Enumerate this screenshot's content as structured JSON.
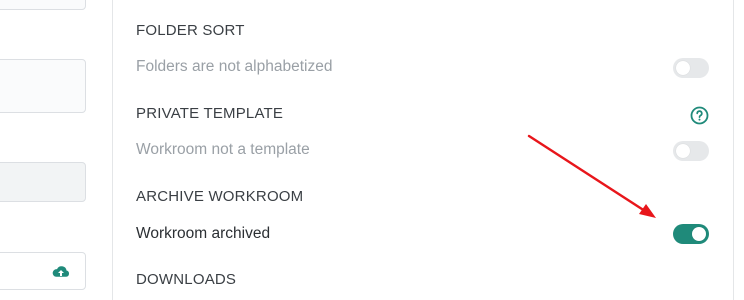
{
  "folder_sort": {
    "title": "FOLDER SORT",
    "label": "Folders are not alphabetized",
    "enabled": false
  },
  "private_template": {
    "title": "PRIVATE TEMPLATE",
    "label": "Workroom not a template",
    "enabled": false,
    "help_icon": "help-circle-icon"
  },
  "archive_workroom": {
    "title": "ARCHIVE WORKROOM",
    "label": "Workroom archived",
    "enabled": true
  },
  "downloads": {
    "title": "DOWNLOADS"
  },
  "icons": {
    "upload": "cloud-upload-icon",
    "annotation": "red-arrow-annotation"
  },
  "colors": {
    "accent": "#1f8a7a",
    "toggle_off": "#e6e8ea",
    "annotation": "#e8161b"
  }
}
